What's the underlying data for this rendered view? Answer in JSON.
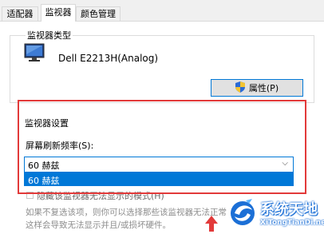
{
  "tabs": [
    {
      "label": "适配器"
    },
    {
      "label": "监视器"
    },
    {
      "label": "颜色管理"
    }
  ],
  "monitor_type": {
    "group_label": "监视器类型",
    "name": "Dell E2213H(Analog)",
    "properties_button": "属性(P)"
  },
  "monitor_settings": {
    "title": "监视器设置",
    "refresh_label": "屏幕刷新频率(S):",
    "refresh_value": "60 赫兹",
    "dropdown_options": [
      "60 赫兹"
    ],
    "hide_modes_label": "隐藏该监视器无法显示的模式(H)",
    "hide_modes_checked": false
  },
  "hint": {
    "line1": "如果不复选该项，则你可以选择那些该监视器无法正常",
    "line2": "这样会导致无法显示并且/或损坏硬件。"
  },
  "watermark": {
    "title": "系统天地",
    "subtitle": "XiTongTianDi.net"
  },
  "colors": {
    "accent": "#0078d7",
    "highlight": "#e23a3a"
  }
}
